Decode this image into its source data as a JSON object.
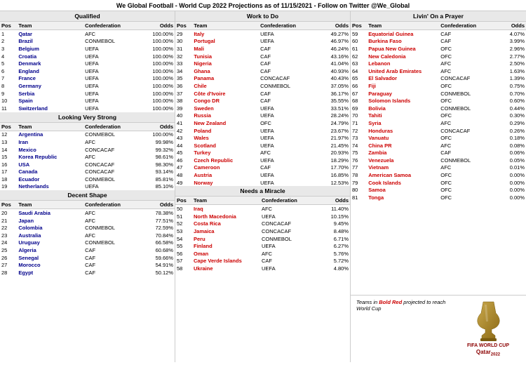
{
  "header": "We Global Football - World Cup 2022 Projections as of 11/15/2021 - Follow on Twitter @We_Global",
  "columns": {
    "col1": {
      "sections": [
        {
          "title": "Qualified",
          "rows": [
            {
              "pos": "Pos",
              "team": "Team",
              "conf": "Confederation",
              "odds": "Odds",
              "header": true
            },
            {
              "pos": "1",
              "team": "Qatar",
              "conf": "AFC",
              "odds": "100.00%"
            },
            {
              "pos": "2",
              "team": "Brazil",
              "conf": "CONMEBOL",
              "odds": "100.00%"
            },
            {
              "pos": "3",
              "team": "Belgium",
              "conf": "UEFA",
              "odds": "100.00%"
            },
            {
              "pos": "4",
              "team": "Croatia",
              "conf": "UEFA",
              "odds": "100.00%"
            },
            {
              "pos": "5",
              "team": "Denmark",
              "conf": "UEFA",
              "odds": "100.00%"
            },
            {
              "pos": "6",
              "team": "England",
              "conf": "UEFA",
              "odds": "100.00%"
            },
            {
              "pos": "7",
              "team": "France",
              "conf": "UEFA",
              "odds": "100.00%"
            },
            {
              "pos": "8",
              "team": "Germany",
              "conf": "UEFA",
              "odds": "100.00%"
            },
            {
              "pos": "9",
              "team": "Serbia",
              "conf": "UEFA",
              "odds": "100.00%"
            },
            {
              "pos": "10",
              "team": "Spain",
              "conf": "UEFA",
              "odds": "100.00%"
            },
            {
              "pos": "11",
              "team": "Switzerland",
              "conf": "UEFA",
              "odds": "100.00%"
            }
          ]
        },
        {
          "title": "Looking Very Strong",
          "rows": [
            {
              "pos": "Pos",
              "team": "Team",
              "conf": "Confederation",
              "odds": "Odds",
              "header": true
            },
            {
              "pos": "12",
              "team": "Argentina",
              "conf": "CONMEBOL",
              "odds": "100.00%"
            },
            {
              "pos": "13",
              "team": "Iran",
              "conf": "AFC",
              "odds": "99.98%"
            },
            {
              "pos": "14",
              "team": "Mexico",
              "conf": "CONCACAF",
              "odds": "99.32%"
            },
            {
              "pos": "15",
              "team": "Korea Republic",
              "conf": "AFC",
              "odds": "98.61%"
            },
            {
              "pos": "16",
              "team": "USA",
              "conf": "CONCACAF",
              "odds": "98.30%"
            },
            {
              "pos": "17",
              "team": "Canada",
              "conf": "CONCACAF",
              "odds": "93.14%"
            },
            {
              "pos": "18",
              "team": "Ecuador",
              "conf": "CONMEBOL",
              "odds": "85.81%"
            },
            {
              "pos": "19",
              "team": "Netherlands",
              "conf": "UEFA",
              "odds": "85.10%"
            }
          ]
        },
        {
          "title": "Decent Shape",
          "rows": [
            {
              "pos": "Pos",
              "team": "Team",
              "conf": "Confederation",
              "odds": "Odds",
              "header": true
            },
            {
              "pos": "20",
              "team": "Saudi Arabia",
              "conf": "AFC",
              "odds": "78.38%"
            },
            {
              "pos": "21",
              "team": "Japan",
              "conf": "AFC",
              "odds": "77.51%"
            },
            {
              "pos": "22",
              "team": "Colombia",
              "conf": "CONMEBOL",
              "odds": "72.59%"
            },
            {
              "pos": "23",
              "team": "Australia",
              "conf": "AFC",
              "odds": "70.84%"
            },
            {
              "pos": "24",
              "team": "Uruguay",
              "conf": "CONMEBOL",
              "odds": "66.58%"
            },
            {
              "pos": "25",
              "team": "Algeria",
              "conf": "CAF",
              "odds": "60.68%"
            },
            {
              "pos": "26",
              "team": "Senegal",
              "conf": "CAF",
              "odds": "59.66%"
            },
            {
              "pos": "27",
              "team": "Morocco",
              "conf": "CAF",
              "odds": "54.91%"
            },
            {
              "pos": "28",
              "team": "Egypt",
              "conf": "CAF",
              "odds": "50.12%"
            }
          ]
        }
      ]
    },
    "col2": {
      "sections": [
        {
          "title": "Work to Do",
          "rows": [
            {
              "pos": "Pos",
              "team": "Team",
              "conf": "Confederation",
              "odds": "Odds",
              "header": true
            },
            {
              "pos": "29",
              "team": "Italy",
              "conf": "UEFA",
              "odds": "49.27%"
            },
            {
              "pos": "30",
              "team": "Portugal",
              "conf": "UEFA",
              "odds": "46.97%"
            },
            {
              "pos": "31",
              "team": "Mali",
              "conf": "CAF",
              "odds": "46.24%"
            },
            {
              "pos": "32",
              "team": "Tunisia",
              "conf": "CAF",
              "odds": "43.16%"
            },
            {
              "pos": "33",
              "team": "Nigeria",
              "conf": "CAF",
              "odds": "41.04%"
            },
            {
              "pos": "34",
              "team": "Ghana",
              "conf": "CAF",
              "odds": "40.93%"
            },
            {
              "pos": "35",
              "team": "Panama",
              "conf": "CONCACAF",
              "odds": "40.43%"
            },
            {
              "pos": "36",
              "team": "Chile",
              "conf": "CONMEBOL",
              "odds": "37.05%"
            },
            {
              "pos": "37",
              "team": "Côte d'Ivoire",
              "conf": "CAF",
              "odds": "36.17%"
            },
            {
              "pos": "38",
              "team": "Congo DR",
              "conf": "CAF",
              "odds": "35.55%"
            },
            {
              "pos": "39",
              "team": "Sweden",
              "conf": "UEFA",
              "odds": "33.51%"
            },
            {
              "pos": "40",
              "team": "Russia",
              "conf": "UEFA",
              "odds": "28.24%"
            },
            {
              "pos": "41",
              "team": "New Zealand",
              "conf": "OFC",
              "odds": "24.79%"
            },
            {
              "pos": "42",
              "team": "Poland",
              "conf": "UEFA",
              "odds": "23.67%"
            },
            {
              "pos": "43",
              "team": "Wales",
              "conf": "UEFA",
              "odds": "21.97%"
            },
            {
              "pos": "44",
              "team": "Scotland",
              "conf": "UEFA",
              "odds": "21.45%"
            },
            {
              "pos": "45",
              "team": "Turkey",
              "conf": "AFC",
              "odds": "20.93%"
            },
            {
              "pos": "46",
              "team": "Czech Republic",
              "conf": "UEFA",
              "odds": "18.29%"
            },
            {
              "pos": "47",
              "team": "Cameroon",
              "conf": "CAF",
              "odds": "17.70%"
            },
            {
              "pos": "48",
              "team": "Austria",
              "conf": "UEFA",
              "odds": "16.85%"
            },
            {
              "pos": "49",
              "team": "Norway",
              "conf": "UEFA",
              "odds": "12.53%"
            }
          ]
        },
        {
          "title": "Needs a Miracle",
          "rows": [
            {
              "pos": "Pos",
              "team": "Team",
              "conf": "Confederation",
              "odds": "Odds",
              "header": true
            },
            {
              "pos": "50",
              "team": "Iraq",
              "conf": "AFC",
              "odds": "11.40%"
            },
            {
              "pos": "51",
              "team": "North Macedonia",
              "conf": "UEFA",
              "odds": "10.15%"
            },
            {
              "pos": "52",
              "team": "Costa Rica",
              "conf": "CONCACAF",
              "odds": "9.45%"
            },
            {
              "pos": "53",
              "team": "Jamaica",
              "conf": "CONCACAF",
              "odds": "8.48%"
            },
            {
              "pos": "54",
              "team": "Peru",
              "conf": "CONMEBOL",
              "odds": "6.71%"
            },
            {
              "pos": "55",
              "team": "Finland",
              "conf": "UEFA",
              "odds": "6.27%"
            },
            {
              "pos": "56",
              "team": "Oman",
              "conf": "AFC",
              "odds": "5.76%"
            },
            {
              "pos": "57",
              "team": "Cape Verde Islands",
              "conf": "CAF",
              "odds": "5.72%"
            },
            {
              "pos": "58",
              "team": "Ukraine",
              "conf": "UEFA",
              "odds": "4.80%"
            }
          ]
        }
      ]
    },
    "col3": {
      "sections": [
        {
          "title": "Livin' On a Prayer",
          "rows": [
            {
              "pos": "Pos",
              "team": "Team",
              "conf": "Confederation",
              "odds": "Odds",
              "header": true
            },
            {
              "pos": "59",
              "team": "Equatorial Guinea",
              "conf": "CAF",
              "odds": "4.07%"
            },
            {
              "pos": "60",
              "team": "Burkina Faso",
              "conf": "CAF",
              "odds": "3.99%"
            },
            {
              "pos": "61",
              "team": "Papua New Guinea",
              "conf": "OFC",
              "odds": "2.96%"
            },
            {
              "pos": "62",
              "team": "New Caledonia",
              "conf": "OFC",
              "odds": "2.77%"
            },
            {
              "pos": "63",
              "team": "Lebanon",
              "conf": "AFC",
              "odds": "2.50%"
            },
            {
              "pos": "64",
              "team": "United Arab Emirates",
              "conf": "AFC",
              "odds": "1.63%"
            },
            {
              "pos": "65",
              "team": "El Salvador",
              "conf": "CONCACAF",
              "odds": "1.39%"
            },
            {
              "pos": "66",
              "team": "Fiji",
              "conf": "OFC",
              "odds": "0.75%"
            },
            {
              "pos": "67",
              "team": "Paraguay",
              "conf": "CONMEBOL",
              "odds": "0.70%"
            },
            {
              "pos": "68",
              "team": "Solomon Islands",
              "conf": "OFC",
              "odds": "0.60%"
            },
            {
              "pos": "69",
              "team": "Bolivia",
              "conf": "CONMEBOL",
              "odds": "0.44%"
            },
            {
              "pos": "70",
              "team": "Tahiti",
              "conf": "OFC",
              "odds": "0.30%"
            },
            {
              "pos": "71",
              "team": "Syria",
              "conf": "AFC",
              "odds": "0.29%"
            },
            {
              "pos": "72",
              "team": "Honduras",
              "conf": "CONCACAF",
              "odds": "0.26%"
            },
            {
              "pos": "73",
              "team": "Vanuatu",
              "conf": "OFC",
              "odds": "0.18%"
            },
            {
              "pos": "74",
              "team": "China PR",
              "conf": "AFC",
              "odds": "0.08%"
            },
            {
              "pos": "75",
              "team": "Zambia",
              "conf": "CAF",
              "odds": "0.06%"
            },
            {
              "pos": "76",
              "team": "Venezuela",
              "conf": "CONMEBOL",
              "odds": "0.05%"
            },
            {
              "pos": "77",
              "team": "Vietnam",
              "conf": "AFC",
              "odds": "0.01%"
            },
            {
              "pos": "78",
              "team": "American Samoa",
              "conf": "OFC",
              "odds": "0.00%"
            },
            {
              "pos": "79",
              "team": "Cook Islands",
              "conf": "OFC",
              "odds": "0.00%"
            },
            {
              "pos": "80",
              "team": "Samoa",
              "conf": "OFC",
              "odds": "0.00%"
            },
            {
              "pos": "81",
              "team": "Tonga",
              "conf": "OFC",
              "odds": "0.00%"
            }
          ]
        }
      ],
      "note": "Teams in Bold Red projected to reach World Cup"
    }
  },
  "logo": {
    "text1": "FIFA WORLD CUP",
    "text2": "Qatar 2022"
  }
}
